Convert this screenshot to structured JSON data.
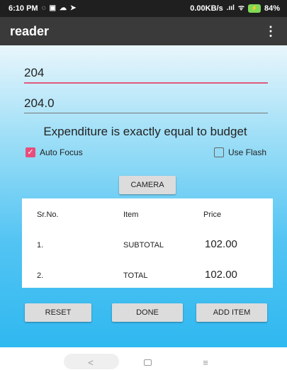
{
  "status_bar": {
    "time": "6:10 PM",
    "speed": "0.00KB/s",
    "signal": ".ııl",
    "wifi": "ᯤ",
    "battery": "84%",
    "battery_color": "#7ed957"
  },
  "app_bar": {
    "title": "reader",
    "overflow_icon": "more-vert-icon"
  },
  "form": {
    "field_1_value": "204",
    "field_2_value": "204.0",
    "message": "Expenditure is exactly equal to budget"
  },
  "checkboxes": {
    "auto_focus": {
      "label": "Auto Focus",
      "checked": true
    },
    "use_flash": {
      "label": "Use Flash",
      "checked": false
    }
  },
  "buttons": {
    "camera": "CAMERA",
    "reset": "RESET",
    "done": "DONE",
    "add_item": "ADD ITEM"
  },
  "table": {
    "headers": [
      "Sr.No.",
      "Item",
      "Price"
    ],
    "rows": [
      [
        "1.",
        "SUBTOTAL",
        "102.00"
      ],
      [
        "2.",
        "TOTAL",
        "102.00"
      ]
    ]
  },
  "nav": {
    "back": "<",
    "menu": "≡"
  },
  "colors": {
    "accent": "#e84d7c",
    "app_bar": "#3a3a3a",
    "background_bottom": "#2fb8f0"
  }
}
